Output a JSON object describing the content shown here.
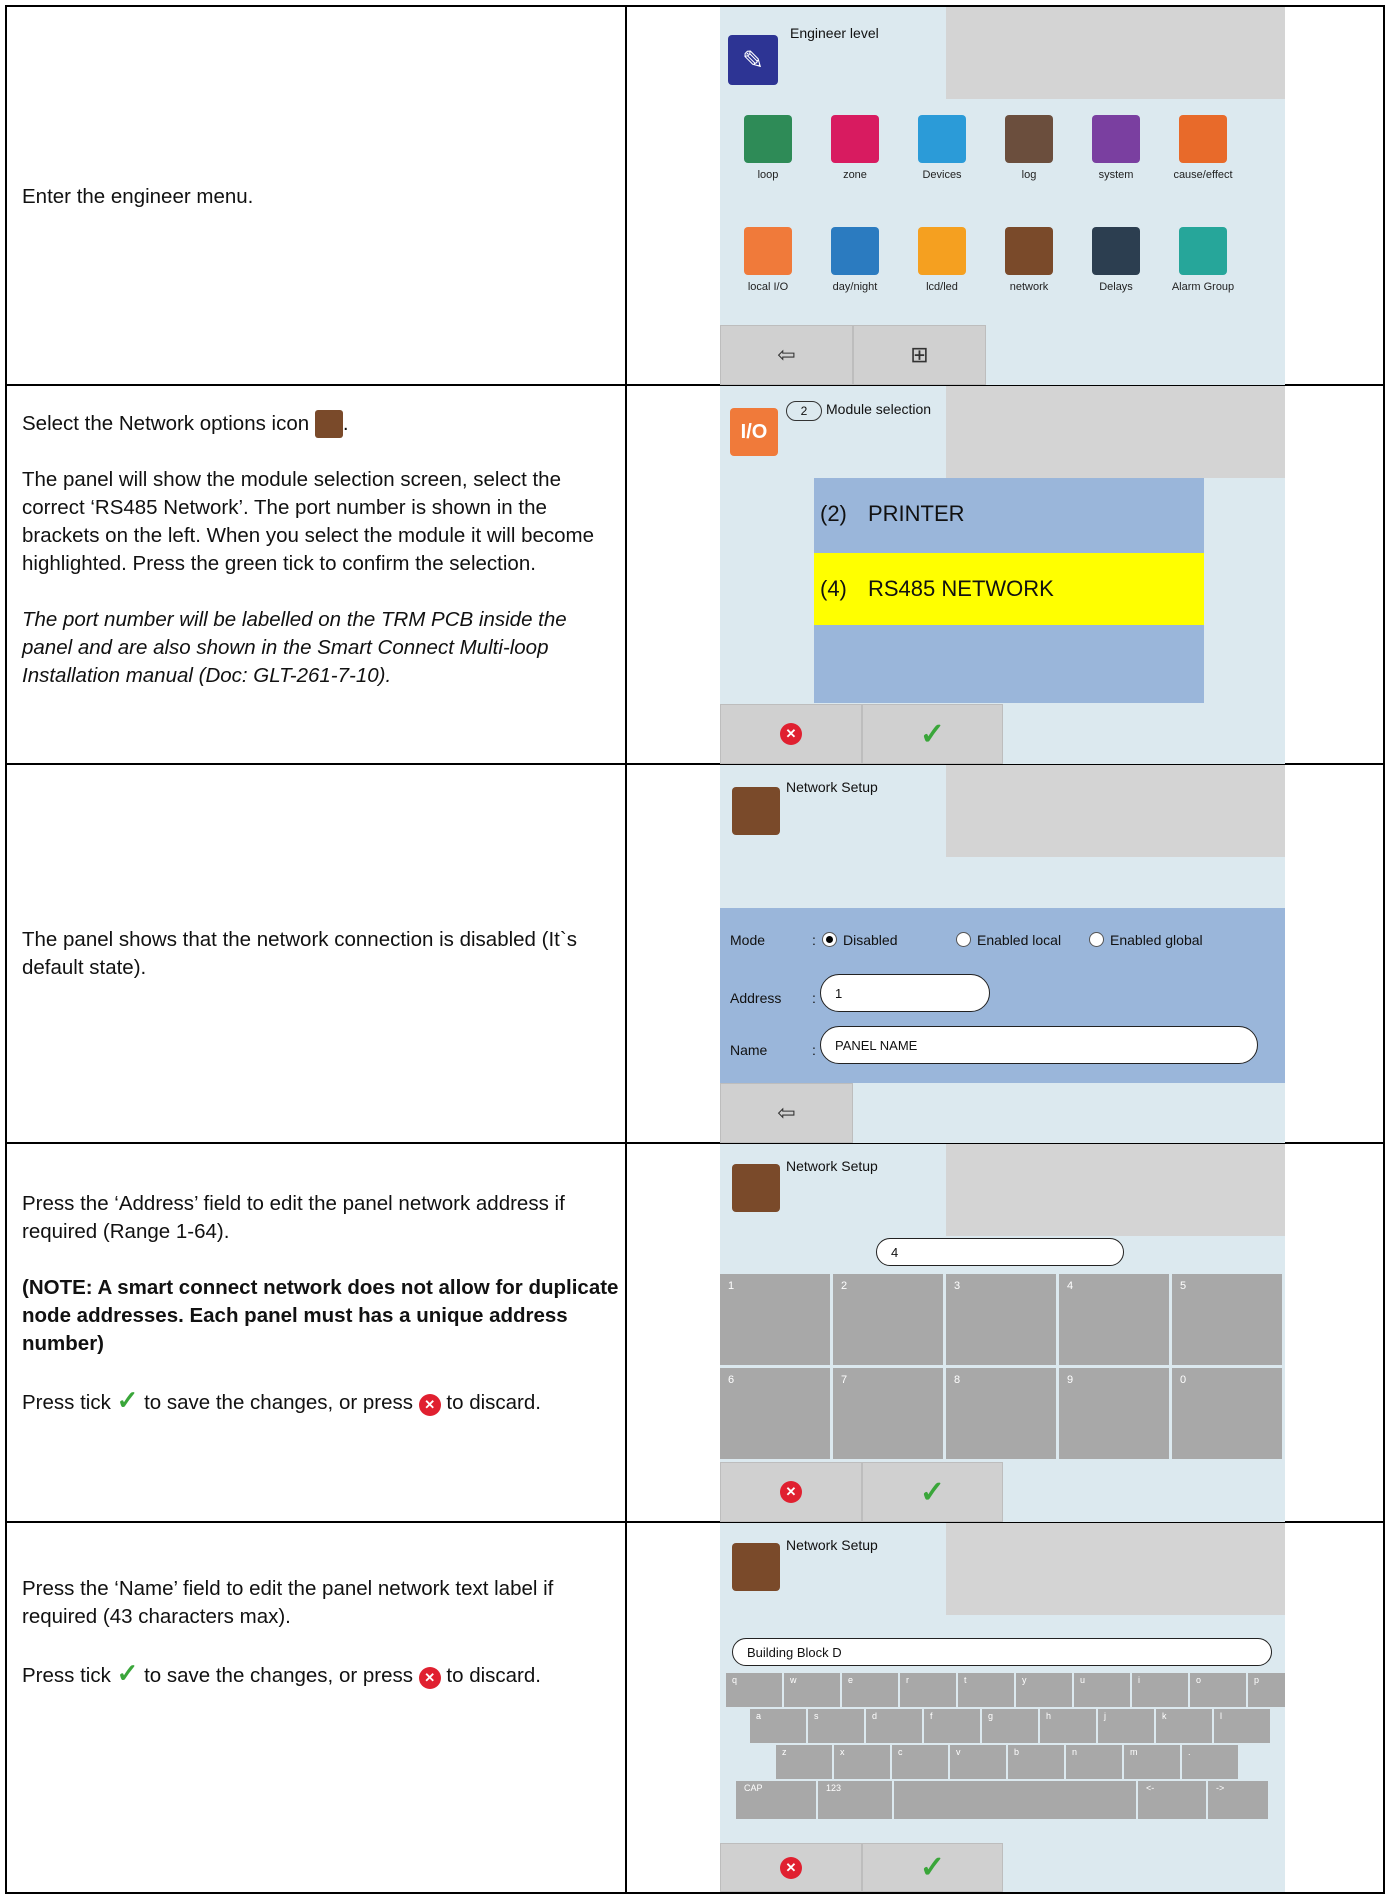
{
  "rows": [
    {
      "text": [
        "Enter the engineer menu."
      ],
      "screen": {
        "title": "Engineer level",
        "items_row1": [
          {
            "label": "loop",
            "icon": "loop-icon",
            "color": "#2e8b57"
          },
          {
            "label": "zone",
            "icon": "zone-icon",
            "color": "#d81b60"
          },
          {
            "label": "Devices",
            "icon": "devices-icon",
            "color": "#2b9bd8"
          },
          {
            "label": "log",
            "icon": "log-icon",
            "color": "#6b4e3d"
          },
          {
            "label": "system",
            "icon": "system-icon",
            "color": "#7a3fa0"
          },
          {
            "label": "cause/effect",
            "icon": "cause-effect-icon",
            "color": "#e86a2a"
          }
        ],
        "items_row2": [
          {
            "label": "local I/O",
            "icon": "local-io-icon",
            "color": "#f07a3a"
          },
          {
            "label": "day/night",
            "icon": "day-night-icon",
            "color": "#2b7bc0"
          },
          {
            "label": "lcd/led",
            "icon": "lcd-led-icon",
            "color": "#f5a020"
          },
          {
            "label": "network",
            "icon": "network-icon",
            "color": "#7a4a2a"
          },
          {
            "label": "Delays",
            "icon": "delays-icon",
            "color": "#2c3e50"
          },
          {
            "label": "Alarm Group",
            "icon": "alarm-group-icon",
            "color": "#26a69a"
          }
        ]
      }
    },
    {
      "text_select": "Select the Network options icon",
      "text_p2": "The panel will show the module selection screen, select the correct ‘RS485 Network’. The port number is shown in the brackets on the left. When you select the module it will become highlighted. Press the green tick to confirm the selection.",
      "text_p3": "The port number will be labelled on the TRM PCB inside the panel and are also shown in the Smart Connect Multi-loop Installation manual (Doc: GLT-261-7-10).",
      "screen": {
        "badge": "2",
        "title": "Module selection",
        "modules": [
          {
            "port": "(2)",
            "name": "PRINTER",
            "highlight": false
          },
          {
            "port": "(4)",
            "name": "RS485 NETWORK",
            "highlight": true
          }
        ],
        "highlight_color": "#ffff00"
      }
    },
    {
      "text": "The panel shows that the network connection is disabled (It`s default state).",
      "screen": {
        "title": "Network Setup",
        "mode_label": "Mode",
        "mode_options": [
          "Disabled",
          "Enabled local",
          "Enabled global"
        ],
        "address_label": "Address",
        "address_value": "1",
        "name_label": "Name",
        "name_value": "PANEL NAME",
        "colon": ":"
      }
    },
    {
      "text_p1": "Press the ‘Address’ field to edit the panel network address if required (Range 1-64).",
      "text_note": "(NOTE: A smart connect network does not allow for duplicate node addresses. Each panel must has a unique address number)",
      "text_tick_a": "Press tick",
      "text_tick_b": "to save the changes, or press",
      "text_tick_c": "to discard.",
      "screen": {
        "title": "Network Setup",
        "value": "4",
        "keys": [
          "1",
          "2",
          "3",
          "4",
          "5",
          "6",
          "7",
          "8",
          "9",
          "0"
        ]
      }
    },
    {
      "text_p1": "Press the ‘Name’ field to edit the panel network text label if required (43 characters max).",
      "text_tick_a": "Press tick",
      "text_tick_b": "to save the changes, or press",
      "text_tick_c": "to discard.",
      "screen": {
        "title": "Network Setup",
        "value": "Building Block D",
        "keys_row1": [
          "q",
          "w",
          "e",
          "r",
          "t",
          "y",
          "u",
          "i",
          "o",
          "p"
        ],
        "keys_row2": [
          "a",
          "s",
          "d",
          "f",
          "g",
          "h",
          "j",
          "k",
          "l"
        ],
        "keys_row3": [
          "z",
          "x",
          "c",
          "v",
          "b",
          "n",
          "m",
          "."
        ],
        "keys_row4": [
          "CAP",
          "123",
          "",
          "<-",
          "->"
        ]
      }
    }
  ]
}
